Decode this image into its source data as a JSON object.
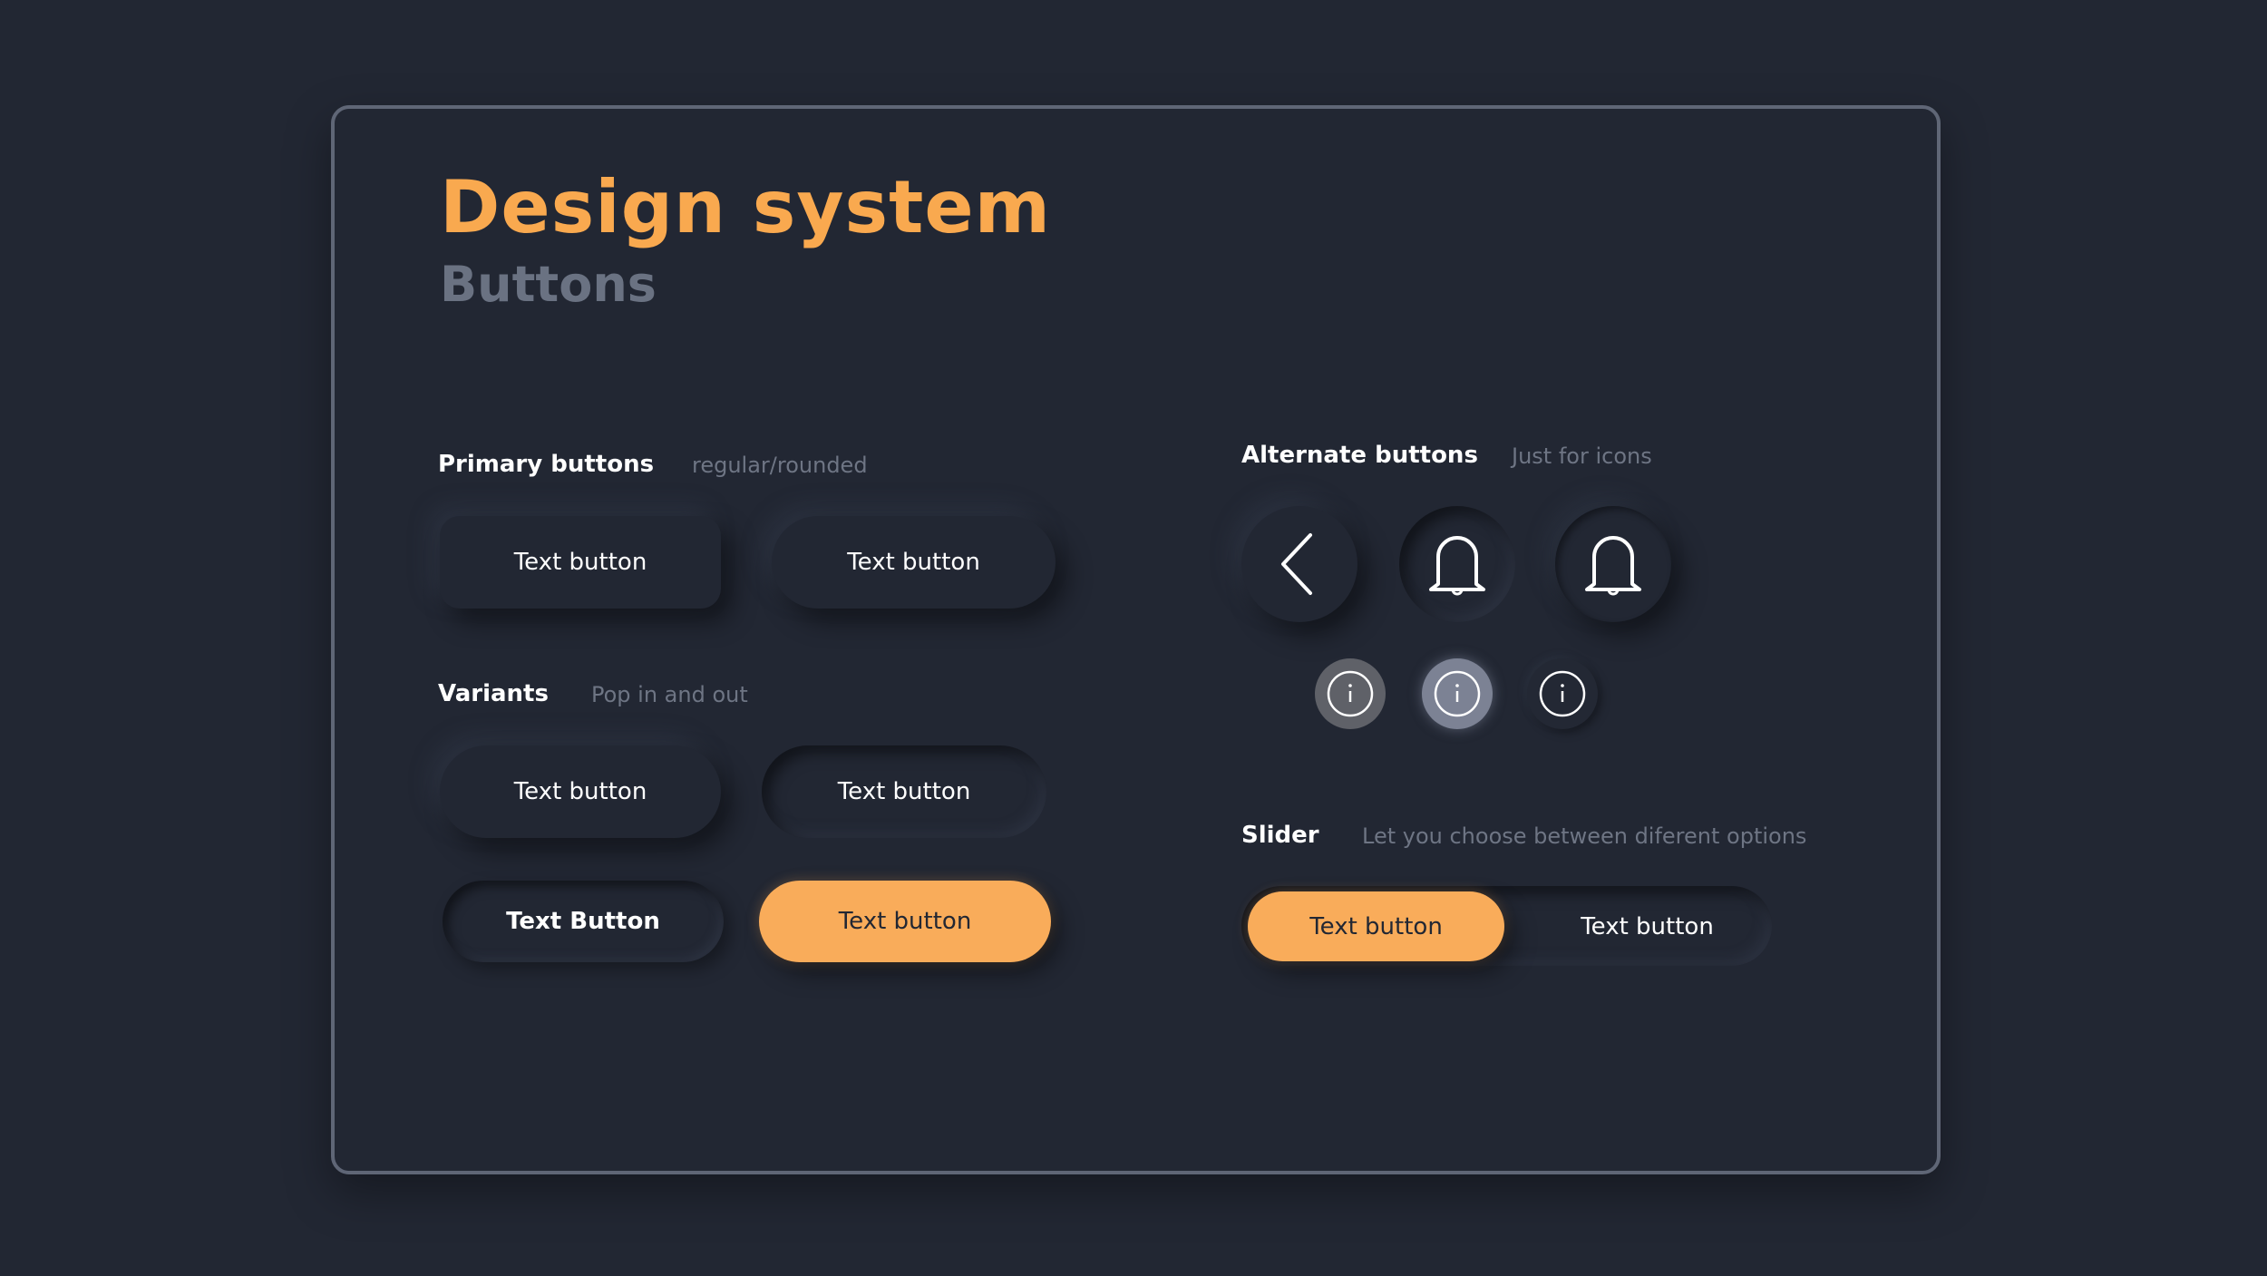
{
  "header": {
    "title": "Design system",
    "subtitle": "Buttons"
  },
  "primary": {
    "label": "Primary buttons",
    "description": "regular/rounded",
    "buttons": [
      "Text button",
      "Text button"
    ]
  },
  "variants": {
    "label": "Variants",
    "description": "Pop in and out",
    "buttons": [
      "Text button",
      "Text button",
      "Text Button",
      "Text button"
    ]
  },
  "alternate": {
    "label": "Alternate buttons",
    "description": "Just for icons",
    "icons": [
      "chevron-left-icon",
      "bell-icon",
      "bell-icon",
      "info-icon",
      "info-icon",
      "info-icon"
    ]
  },
  "slider": {
    "label": "Slider",
    "description": "Let you choose between diferent options",
    "options": [
      "Text button",
      "Text button"
    ],
    "selected_index": 0
  },
  "colors": {
    "accent": "#f9ac5a",
    "background": "#222733",
    "muted": "#6e7584"
  }
}
